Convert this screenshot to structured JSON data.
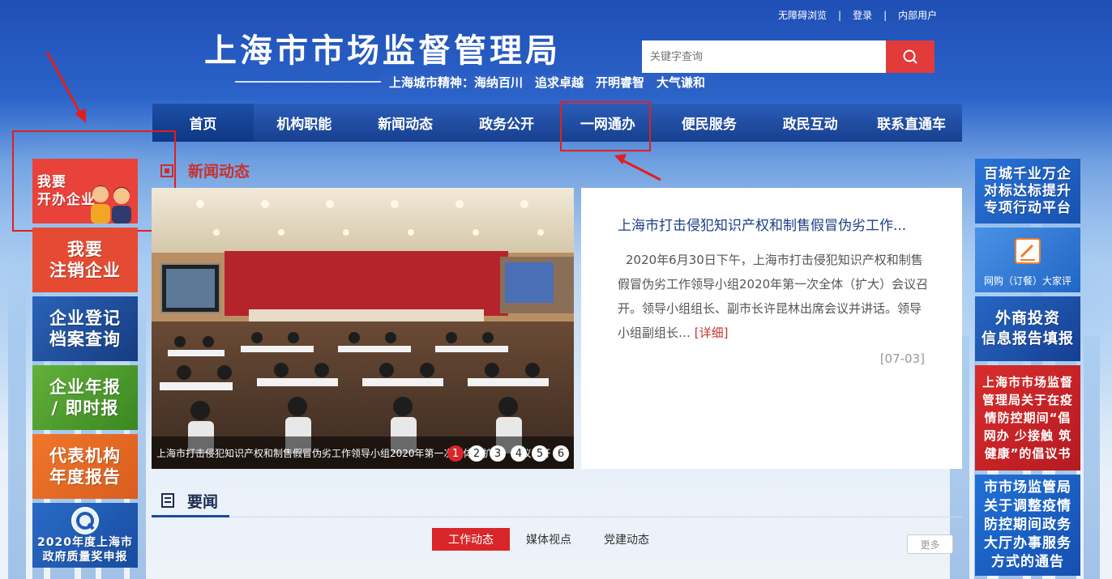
{
  "header": {
    "top_links": [
      "无障碍浏览",
      "登录",
      "内部用户"
    ],
    "site_title": "上海市市场监督管理局",
    "slogan": "上海城市精神：海纳百川　追求卓越　开明睿智　大气谦和",
    "search_placeholder": "关键字查询"
  },
  "nav": {
    "items": [
      "首页",
      "机构职能",
      "新闻动态",
      "政务公开",
      "一网通办",
      "便民服务",
      "政民互动",
      "联系直通车"
    ]
  },
  "left_tiles": [
    {
      "line1": "我要",
      "line2": "开办企业",
      "color": "#e9423a"
    },
    {
      "line1": "我要",
      "line2": "注销企业",
      "color": "#e54b32"
    },
    {
      "line1": "企业登记",
      "line2": "档案查询",
      "color": "#1f4f9a"
    },
    {
      "line1": "企业年报",
      "line2": "/ 即时报",
      "color": "#4d9a2e"
    },
    {
      "line1": "代表机构",
      "line2": "年度报告",
      "color": "#e86a27"
    },
    {
      "line1": "2020年度上海市",
      "line2": "政府质量奖申报",
      "color": "#1f5bb5"
    }
  ],
  "right_tiles": [
    {
      "line1": "百城千业万企",
      "line2": "对标达标提升",
      "line3": "专项行动平台",
      "color": "#1c5fc4"
    },
    {
      "line1": "网购（订餐）大家评",
      "color": "#2c7ad6"
    },
    {
      "line1": "外商投资",
      "line2": "信息报告填报",
      "color": "#1f55b5"
    },
    {
      "line1": "上海市市场监督管理局关于在疫情防控期间“倡网办 少接触 筑健康”的倡议书",
      "color": "#c8222a"
    },
    {
      "line1": "市市场监管局关于调整疫情防控期间政务大厅办事服务方式的通告",
      "color": "#1b5bc0"
    }
  ],
  "news": {
    "section_label": "新闻动态",
    "photo_caption": "上海市打击侵犯知识产权和制售假冒伪劣工作领导小组2020年第一次全体（扩大）会议召开",
    "slide_numbers": [
      "1",
      "2",
      "3",
      "4",
      "5",
      "6"
    ],
    "headline": "上海市打击侵犯知识产权和制售假冒伪劣工作...",
    "body": "2020年6月30日下午，上海市打击侵犯知识产权和制售假冒伪劣工作领导小组2020年第一次全体（扩大）会议召开。领导小组组长、副市长许昆林出席会议并讲话。领导小组副组长…",
    "detail_link": "[详细]",
    "date": "[07-03]"
  },
  "yaowen": {
    "label": "要闻",
    "tabs": [
      "工作动态",
      "媒体视点",
      "党建动态"
    ],
    "more": "更多"
  },
  "colors": {
    "nav": "#1c4aa0",
    "accent_red": "#d9262a",
    "title_blue": "#1c3f86"
  }
}
